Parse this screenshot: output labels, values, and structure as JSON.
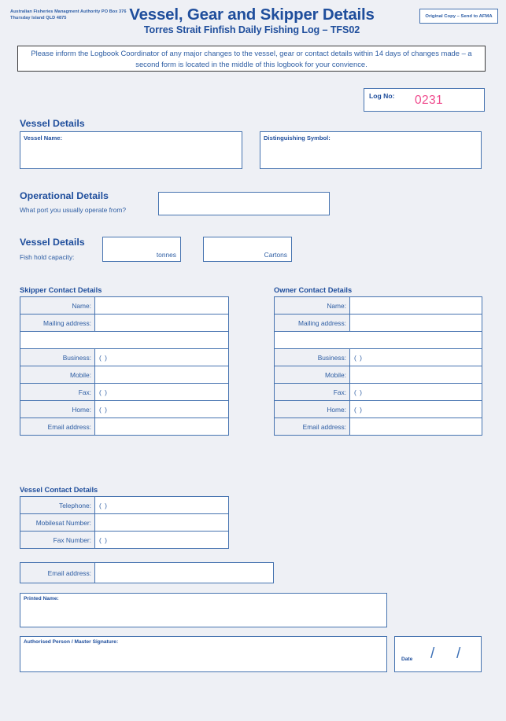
{
  "header": {
    "agency": "Australian Fisheries Managment Authority PO Box 376 Thursday Island QLD 4875",
    "title": "Vessel, Gear and Skipper Details",
    "subtitle": "Torres Strait Finfish Daily Fishing Log – TFS02",
    "copy_notice": "Original Copy – Send to AFMA"
  },
  "notice": {
    "text": "Please inform the Logbook Coordinator of any major changes to the vessel, gear or contact details within 14 days of changes made – a second form is located in the middle of this logbook for your convience."
  },
  "log_no": {
    "label": "Log No:",
    "value": "0231",
    "value_color": "#ef4a8d"
  },
  "vessel_details": {
    "heading": "Vessel Details",
    "vessel_name_label": "Vessel Name:",
    "distinguishing_symbol_label": "Distinguishing Symbol:",
    "vessel_name_value": "",
    "distinguishing_symbol_value": ""
  },
  "operational_details": {
    "heading": "Operational Details",
    "question": "What port you usually operate from?",
    "port_value": ""
  },
  "fish_hold": {
    "heading": "Vessel Details",
    "label": "Fish hold capacity:",
    "tonnes_value": "",
    "tonnes_unit": "tonnes",
    "cartons_value": "",
    "cartons_unit": "Cartons"
  },
  "skipper_contact": {
    "heading": "Skipper Contact Details",
    "rows": [
      {
        "label": "Name:",
        "value": ""
      },
      {
        "label": "Mailing address:",
        "value": ""
      },
      {
        "label": "",
        "value": ""
      },
      {
        "label": "Business:",
        "value": "(     )"
      },
      {
        "label": "Mobile:",
        "value": ""
      },
      {
        "label": "Fax:",
        "value": "(     )"
      },
      {
        "label": "Home:",
        "value": "(     )"
      },
      {
        "label": "Email address:",
        "value": ""
      }
    ]
  },
  "owner_contact": {
    "heading": "Owner Contact Details",
    "rows": [
      {
        "label": "Name:",
        "value": ""
      },
      {
        "label": "Mailing address:",
        "value": ""
      },
      {
        "label": "",
        "value": ""
      },
      {
        "label": "Business:",
        "value": "(     )"
      },
      {
        "label": "Mobile:",
        "value": ""
      },
      {
        "label": "Fax:",
        "value": "(     )"
      },
      {
        "label": "Home:",
        "value": "(     )"
      },
      {
        "label": "Email address:",
        "value": ""
      }
    ]
  },
  "vessel_contact": {
    "heading": "Vessel Contact Details",
    "rows": [
      {
        "label": "Telephone:",
        "value": "(     )"
      },
      {
        "label": "Mobilesat Number:",
        "value": ""
      },
      {
        "label": "Fax Number:",
        "value": "(     )"
      },
      {
        "label": "Email address:",
        "value": ""
      }
    ]
  },
  "signature": {
    "printed_name_label": "Printed Name:",
    "printed_name_value": "",
    "authorised_label": "Authorised Person / Master Signature:",
    "authorised_value": "",
    "date_label": "Date",
    "date_sep_1": "/",
    "date_sep_2": "/"
  }
}
